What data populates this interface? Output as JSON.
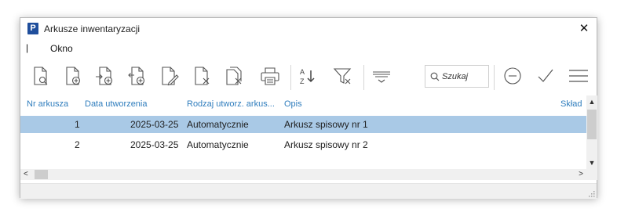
{
  "window": {
    "title": "Arkusze inwentaryzacji",
    "app_logo": "P",
    "close_glyph": "✕"
  },
  "menubar": {
    "separator": "|",
    "items": [
      "Okno"
    ]
  },
  "toolbar": {
    "buttons": [
      "document-search-icon",
      "document-add-icon",
      "document-import-add-icon",
      "document-export-add-icon",
      "document-edit-icon",
      "document-delete-icon",
      "document-copy-delete-icon",
      "print-icon",
      "sort-az-icon",
      "filter-icon",
      "group-icon",
      "collapse-icon",
      "approve-icon",
      "menu-icon"
    ],
    "sort_letters": [
      "A",
      "Z"
    ],
    "search_placeholder": "Szukaj"
  },
  "table": {
    "columns": [
      "Nr arkusza",
      "Data utworzenia",
      "Rodzaj utworz. arkus...",
      "Opis",
      "Skład"
    ],
    "rows": [
      {
        "nr": "1",
        "data": "2025-03-25",
        "rodzaj": "Automatycznie",
        "opis": "Arkusz spisowy nr 1",
        "selected": true
      },
      {
        "nr": "2",
        "data": "2025-03-25",
        "rodzaj": "Automatycznie",
        "opis": "Arkusz spisowy nr 2",
        "selected": false
      }
    ]
  },
  "scrollbars": {
    "up": "▲",
    "down": "▼",
    "left": "<",
    "right": ">"
  },
  "colors": {
    "header_text": "#2f7dbd",
    "selected_row": "#a9c9e6",
    "logo_bg": "#1f4e9c"
  }
}
